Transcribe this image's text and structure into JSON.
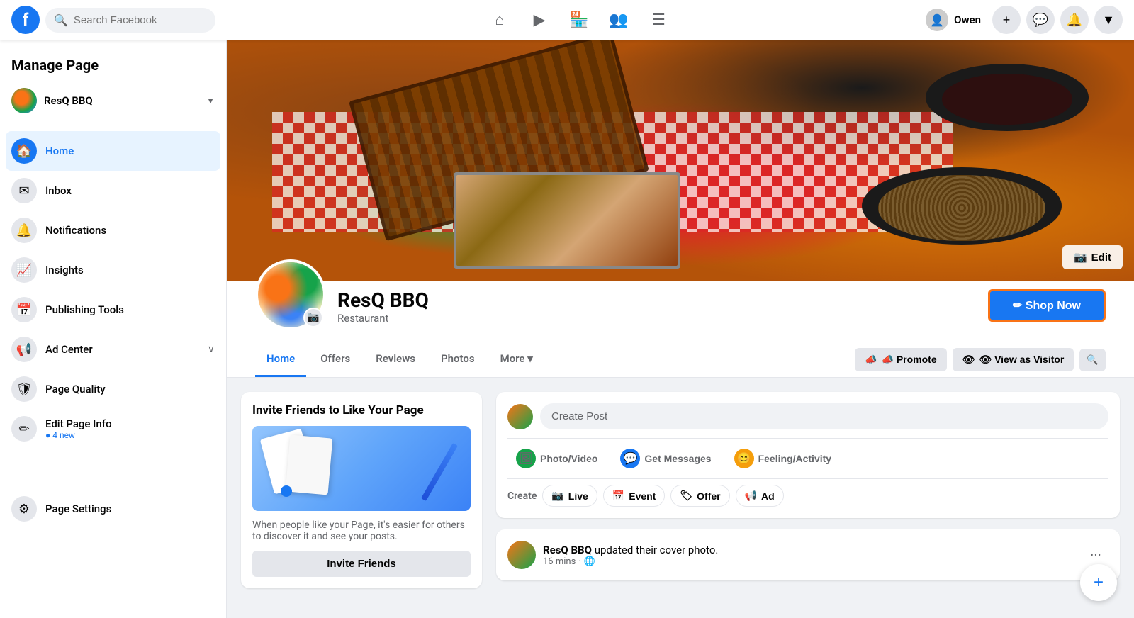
{
  "topnav": {
    "logo_text": "f",
    "search_placeholder": "Search Facebook",
    "nav_icons": [
      "home",
      "video",
      "store",
      "groups",
      "menu"
    ],
    "nav_icon_symbols": [
      "⌂",
      "▶",
      "🏪",
      "👥",
      "☰"
    ],
    "user_name": "Owen",
    "plus_label": "+",
    "messenger_label": "💬",
    "notification_label": "🔔",
    "dropdown_label": "▼"
  },
  "sidebar": {
    "manage_page_title": "Manage Page",
    "page_name": "ResQ BBQ",
    "items": [
      {
        "id": "home",
        "label": "Home",
        "icon": "🏠",
        "active": true
      },
      {
        "id": "inbox",
        "label": "Inbox",
        "icon": "✉",
        "active": false
      },
      {
        "id": "notifications",
        "label": "Notifications",
        "icon": "🔔",
        "active": false
      },
      {
        "id": "insights",
        "label": "Insights",
        "icon": "📈",
        "active": false
      },
      {
        "id": "publishing-tools",
        "label": "Publishing Tools",
        "icon": "📅",
        "active": false
      },
      {
        "id": "ad-center",
        "label": "Ad Center",
        "icon": "📢",
        "active": false,
        "expand": true
      },
      {
        "id": "page-quality",
        "label": "Page Quality",
        "icon": "🛡",
        "active": false
      },
      {
        "id": "edit-page-info",
        "label": "Edit Page Info",
        "icon": "✏",
        "active": false,
        "badge": "4 new"
      }
    ],
    "page_settings_label": "Page Settings",
    "page_settings_icon": "⚙"
  },
  "page": {
    "name": "ResQ BBQ",
    "category": "Restaurant",
    "cover_edit_label": "Edit",
    "camera_icon": "📷",
    "shop_now_label": "✏ Shop Now",
    "tabs": [
      {
        "label": "Home",
        "active": true
      },
      {
        "label": "Offers",
        "active": false
      },
      {
        "label": "Reviews",
        "active": false
      },
      {
        "label": "Photos",
        "active": false
      },
      {
        "label": "More ▾",
        "active": false
      }
    ],
    "promote_label": "📣 Promote",
    "view_visitor_label": "👁 View as Visitor",
    "search_label": "🔍"
  },
  "invite_card": {
    "title": "Invite Friends to Like Your Page",
    "description": "When people like your Page, it's easier for others to discover it and see your posts.",
    "btn_label": "Invite Friends"
  },
  "create_post": {
    "post_placeholder": "Create Post",
    "photo_video_label": "Photo/Video",
    "get_messages_label": "Get Messages",
    "feeling_label": "Feeling/Activity",
    "create_label": "Create",
    "live_label": "Live",
    "event_label": "Event",
    "offer_label": "Offer",
    "ad_label": "Ad"
  },
  "recent_post": {
    "author": "ResQ BBQ",
    "action": "updated their cover photo.",
    "time": "16 mins",
    "globe_icon": "🌐"
  },
  "fab": {
    "label": "+"
  }
}
